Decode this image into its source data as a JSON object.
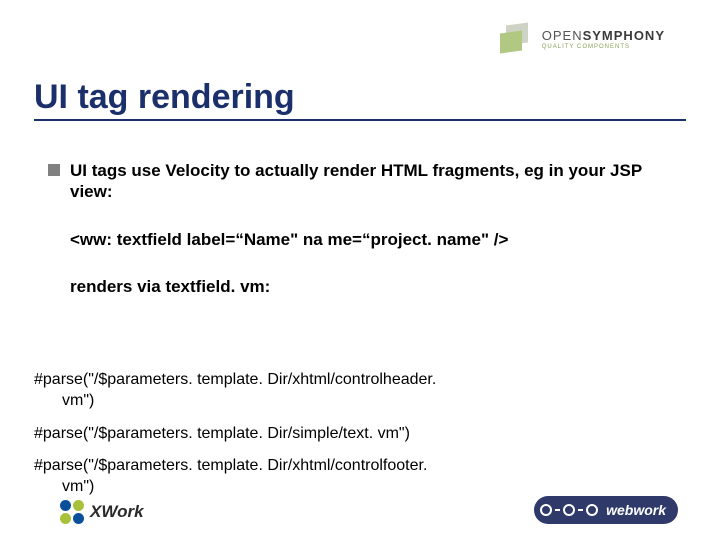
{
  "header": {
    "brand_open": "OPEN",
    "brand_symphony": "SYMPHONY",
    "brand_tag": "QUALITY COMPONENTS"
  },
  "title": "UI tag rendering",
  "bullets": {
    "b1": "UI tags use Velocity to actually render HTML fragments, eg in your JSP view:",
    "b2": "<ww: textfield label=“Name\" na me=“project. name\" />",
    "b3": "renders via textfield. vm:"
  },
  "code": {
    "l1a": "#parse(\"/$parameters. template. Dir/xhtml/controlheader.",
    "l1b": "vm\")",
    "l2": "#parse(\"/$parameters. template. Dir/simple/text. vm\")",
    "l3a": "#parse(\"/$parameters. template. Dir/xhtml/controlfooter.",
    "l3b": "vm\")"
  },
  "footer": {
    "xwork": "XWork",
    "webwork": "webwork"
  }
}
